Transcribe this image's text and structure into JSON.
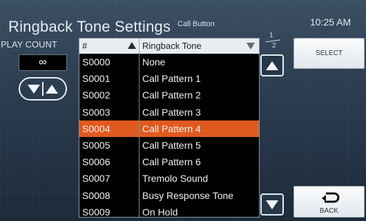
{
  "header": {
    "title": "Ringback Tone Settings",
    "subtitle": "Call Button",
    "time": "10:25 AM"
  },
  "play_count": {
    "label": "PLAY COUNT",
    "value": "∞"
  },
  "list": {
    "columns": {
      "number": "#",
      "tone": "Ringback Tone"
    },
    "selected_index": 4,
    "rows": [
      {
        "number": "S0000",
        "tone": "None"
      },
      {
        "number": "S0001",
        "tone": "Call Pattern 1"
      },
      {
        "number": "S0002",
        "tone": "Call Pattern 2"
      },
      {
        "number": "S0003",
        "tone": "Call Pattern 3"
      },
      {
        "number": "S0004",
        "tone": "Call Pattern 4"
      },
      {
        "number": "S0005",
        "tone": "Call Pattern 5"
      },
      {
        "number": "S0006",
        "tone": "Call Pattern 6"
      },
      {
        "number": "S0007",
        "tone": "Tremolo Sound"
      },
      {
        "number": "S0008",
        "tone": "Busy Response Tone"
      },
      {
        "number": "S0009",
        "tone": "On Hold"
      }
    ]
  },
  "pagination": {
    "current": "1",
    "total": "2"
  },
  "buttons": {
    "select": "SELECT",
    "back": "BACK"
  },
  "icons": {
    "sort_number": "sort-ascending-icon",
    "sort_tone": "sort-descending-icon",
    "stepper_down": "triangle-down-icon",
    "stepper_up": "triangle-up-icon",
    "scroll_up": "triangle-up-icon",
    "scroll_down": "triangle-down-icon",
    "back": "return-arrow-icon"
  },
  "colors": {
    "selected_row": "#e05a1f",
    "list_background": "#000000",
    "header_background": "#e9edf1"
  }
}
